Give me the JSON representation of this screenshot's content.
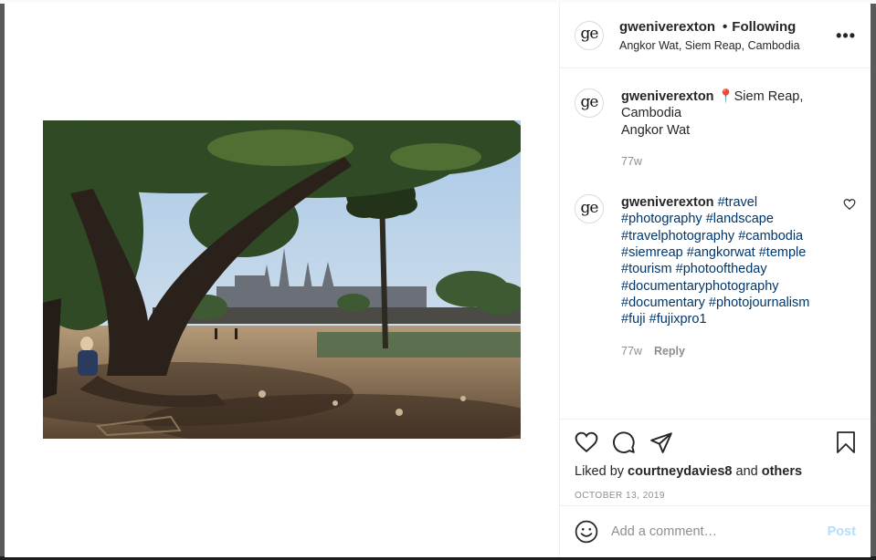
{
  "header": {
    "avatar_text": "ge",
    "username": "gweniverexton",
    "separator": "•",
    "follow_state": "Following",
    "location": "Angkor Wat, Siem Reap, Cambodia",
    "more_icon": "ellipsis-icon",
    "more_label": "•••"
  },
  "caption": {
    "avatar_text": "ge",
    "username": "gweniverexton",
    "pin": "📍",
    "line1": "Siem Reap,",
    "line2": "Cambodia",
    "line3": "Angkor Wat",
    "age": "77w"
  },
  "comment": {
    "avatar_text": "ge",
    "username": "gweniverexton",
    "hashtags": [
      "#travel",
      "#photography",
      "#landscape",
      "#travelphotography",
      "#cambodia",
      "#siemreap",
      "#angkorwat",
      "#temple",
      "#tourism",
      "#photooftheday",
      "#documentaryphotography",
      "#documentary",
      "#photojournalism",
      "#fuji",
      "#fujixpro1"
    ],
    "age": "77w",
    "reply_label": "Reply",
    "like_icon": "heart-outline-icon"
  },
  "actions": {
    "icons": [
      "heart-icon",
      "comment-icon",
      "share-icon",
      "bookmark-icon"
    ],
    "liked_prefix": "Liked by ",
    "liked_user": "courtneydavies8",
    "liked_and": " and ",
    "liked_others": "others",
    "date": "OCTOBER 13, 2019"
  },
  "add_comment": {
    "emoji_icon": "smiley-icon",
    "placeholder": "Add a comment…",
    "post_label": "Post"
  },
  "colors": {
    "link": "#00376b",
    "muted": "#8e8e8e",
    "post_disabled": "#b2dffc"
  }
}
